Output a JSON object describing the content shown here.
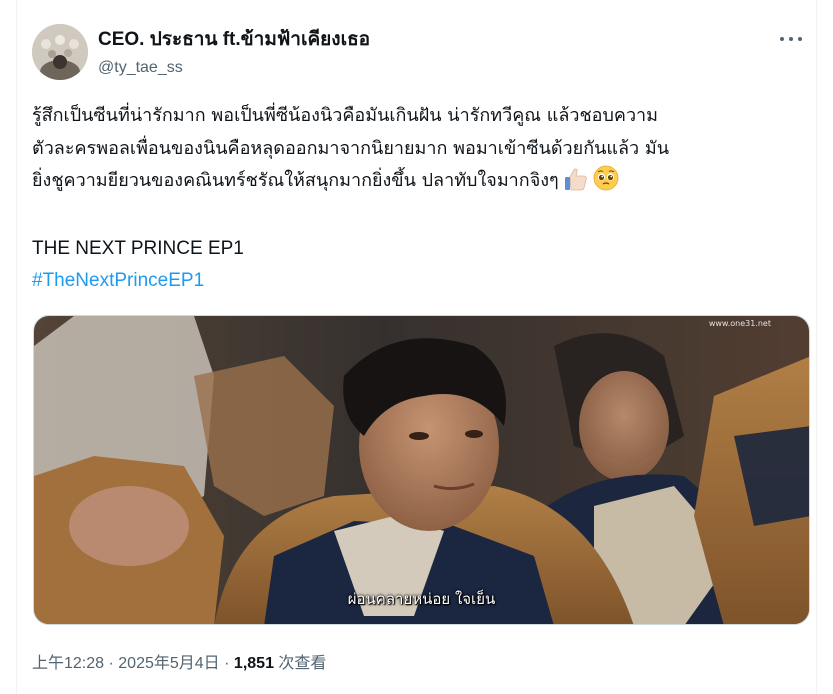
{
  "tweet": {
    "author": {
      "display_name": "CEO. ประธาน ft.ข้ามฟ้าเคียงเธอ",
      "handle": "@ty_tae_ss"
    },
    "text_lines": [
      "รู้สึกเป็นซีนที่น่ารักมาก พอเป็นพี่ซีน้องนิวคือมันเกินฝัน น่ารักทวีคูณ แล้วชอบความ",
      "ตัวละครพอลเพื่อนของนินคือหลุดออกมาจากนิยายมาก พอมาเข้าซีนด้วยกันแล้ว มัน",
      "ยิ่งชูความยียวนของคณินทร์ชรัณให้สนุกมากยิ่งขึ้น ปลาทับใจมากจิงๆ"
    ],
    "emojis": [
      "thumbs-up-emoji",
      "pleading-face-emoji"
    ],
    "title_line": "THE NEXT PRINCE EP1",
    "hashtag": "#TheNextPrinceEP1",
    "media": {
      "watermark": "www.one31.net",
      "subtitle": "ผ่อนคลายหน่อย ใจเย็น"
    },
    "meta": {
      "time": "上午12:28",
      "separator": "·",
      "date": "2025年5月4日",
      "views_count": "1,851",
      "views_label": "次查看"
    }
  },
  "colors": {
    "text_primary": "#0f1419",
    "text_secondary": "#536471",
    "link": "#1d9bf0",
    "border": "#cfd9de"
  }
}
